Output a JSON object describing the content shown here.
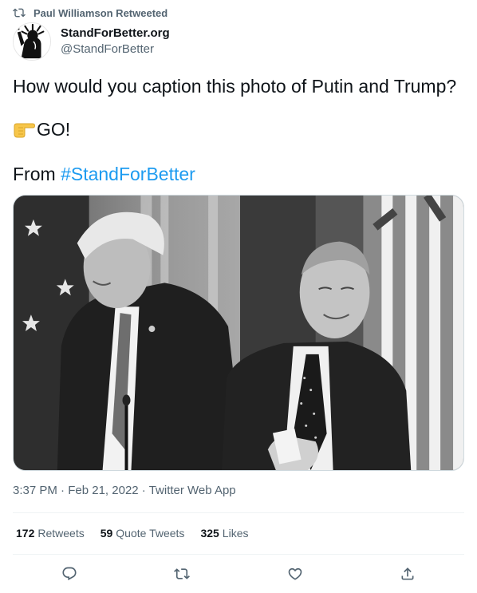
{
  "retweet": {
    "text": "Paul Williamson Retweeted",
    "icon": "retweet-icon"
  },
  "author": {
    "display_name": "StandForBetter.org",
    "handle": "@StandForBetter",
    "avatar_icon": "statue-of-liberty-logo"
  },
  "tweet": {
    "line1": "How would you caption this photo of Putin and Trump?",
    "line2_emoji": "backhand-index-pointing-right-emoji",
    "line2": "GO!",
    "line3_prefix": "From ",
    "hashtag": "#StandForBetter"
  },
  "meta": {
    "time": "3:37 PM",
    "date": "Feb 21, 2022",
    "source": "Twitter Web App",
    "separator": " · "
  },
  "stats": {
    "retweets_count": "172",
    "retweets_label": "Retweets",
    "quote_count": "59",
    "quote_label": "Quote Tweets",
    "likes_count": "325",
    "likes_label": "Likes"
  },
  "actions": [
    {
      "name": "reply",
      "icon": "reply-icon"
    },
    {
      "name": "retweet",
      "icon": "retweet-icon"
    },
    {
      "name": "like",
      "icon": "heart-icon"
    },
    {
      "name": "share",
      "icon": "share-icon"
    }
  ],
  "colors": {
    "link": "#1d9bf0",
    "secondary": "#536471",
    "primary": "#0f1419"
  }
}
